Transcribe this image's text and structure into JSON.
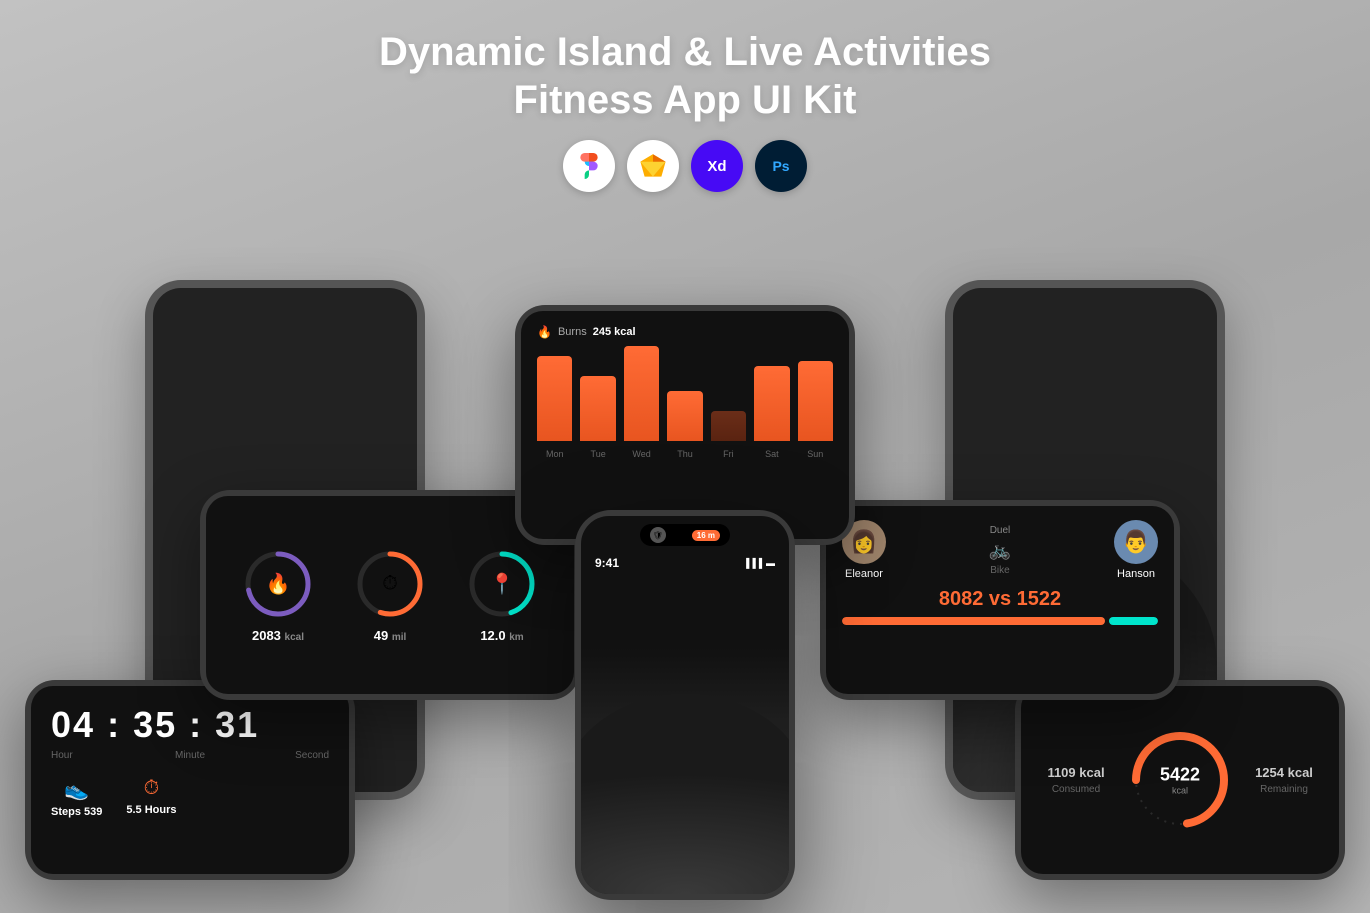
{
  "header": {
    "title_line1": "Dynamic Island & Live Activities",
    "title_line2": "Fitness App UI Kit"
  },
  "tools": [
    {
      "name": "Figma",
      "icon": "figma"
    },
    {
      "name": "Sketch",
      "icon": "sketch"
    },
    {
      "name": "Adobe XD",
      "icon": "xd"
    },
    {
      "name": "Photoshop",
      "icon": "ps"
    }
  ],
  "chart": {
    "label": "Burns",
    "value": "245 kcal",
    "days": [
      "Mon",
      "Tue",
      "Wed",
      "Thu",
      "Fri",
      "Sat",
      "Sun"
    ],
    "heights": [
      85,
      65,
      95,
      50,
      30,
      75,
      80
    ]
  },
  "metrics": [
    {
      "value": "2083",
      "unit": "kcal",
      "color": "#7c5cbf",
      "ring_pct": 0.72
    },
    {
      "value": "49",
      "unit": "mil",
      "color": "#ff6b35",
      "ring_pct": 0.55
    },
    {
      "value": "12.0",
      "unit": "km",
      "color": "#00e5cc",
      "ring_pct": 0.45
    }
  ],
  "duel": {
    "title": "Duel",
    "activity": "Bike",
    "player1": {
      "name": "Eleanor"
    },
    "player2": {
      "name": "Hanson"
    },
    "score": "8082 vs 1522",
    "score1": 8082,
    "score2": 1522
  },
  "timer": {
    "hours": "04",
    "minutes": "35",
    "seconds": "31",
    "label_hour": "Hour",
    "label_minute": "Minute",
    "label_second": "Second",
    "steps_label": "Steps 539",
    "hours_label": "5.5 Hours"
  },
  "phone_status": {
    "time": "9:41",
    "badge": "16 m"
  },
  "kcal_ring": {
    "consumed": "1109 kcal",
    "consumed_label": "Consumed",
    "total": "5422",
    "unit": "kcal",
    "remaining": "1254 kcal",
    "remaining_label": "Remaining"
  }
}
